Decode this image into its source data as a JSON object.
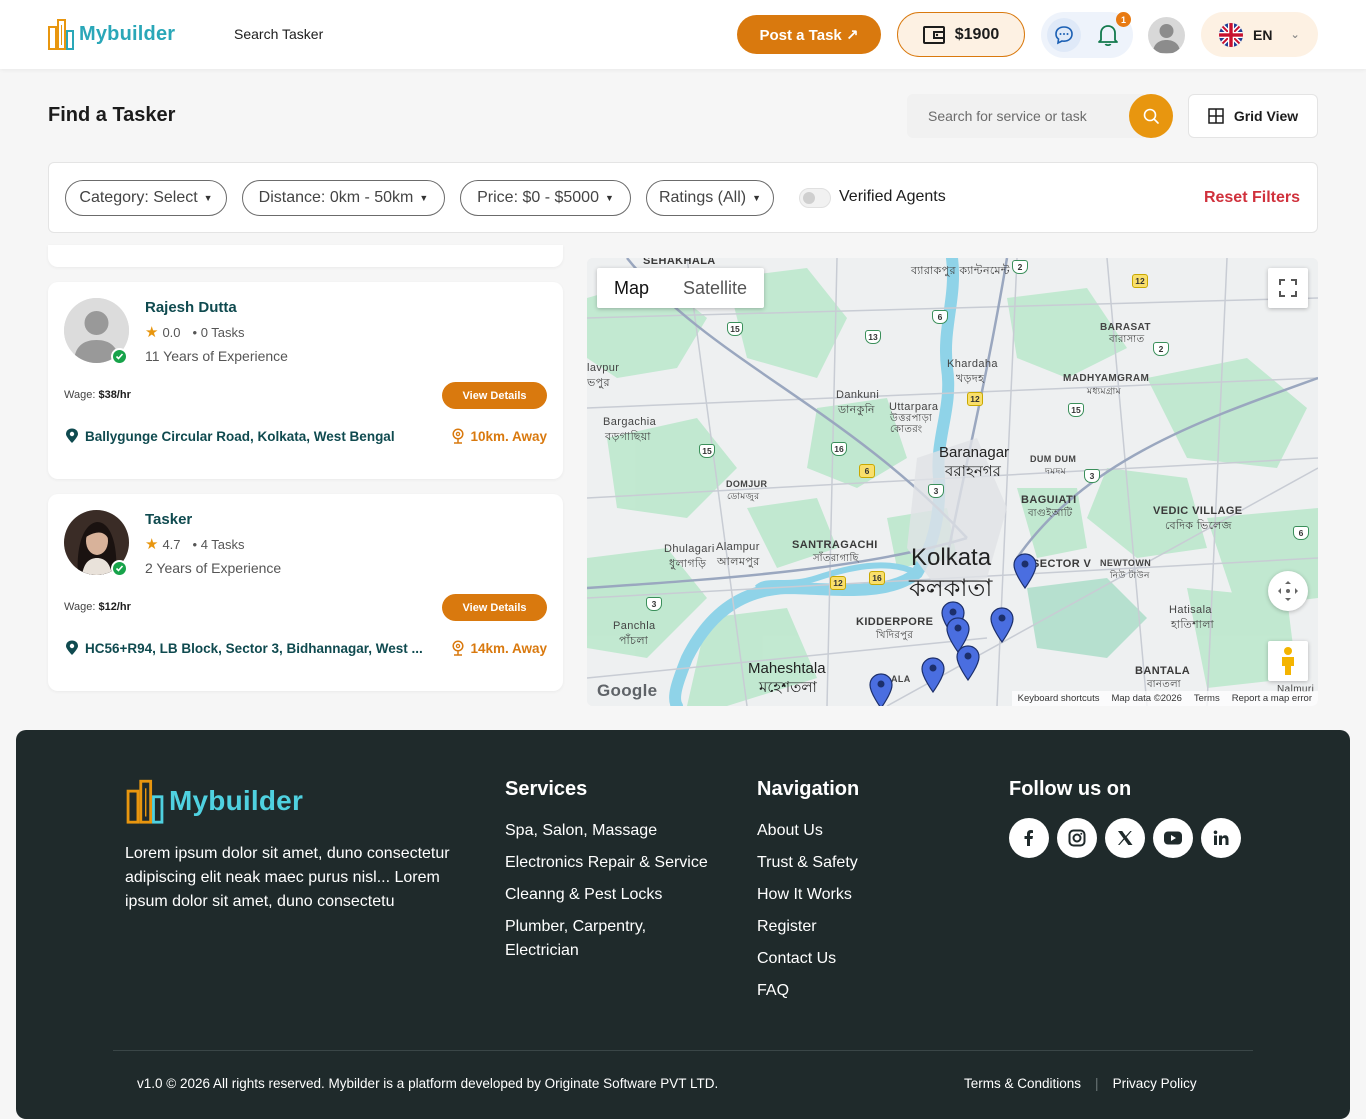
{
  "header": {
    "brand": "Mybuilder",
    "search_tasker": "Search Tasker",
    "post_task": "Post a Task ↗",
    "wallet_balance": "$1900",
    "notification_count": "1",
    "language": "EN"
  },
  "page": {
    "title": "Find a Tasker",
    "search_placeholder": "Search for service or task",
    "grid_view": "Grid View"
  },
  "filters": {
    "category": "Category: Select",
    "distance": "Distance: 0km - 50km",
    "price": "Price: $0 - $5000",
    "ratings": "Ratings (All)",
    "verified_label": "Verified Agents",
    "verified_on": false,
    "reset": "Reset Filters"
  },
  "taskers": [
    {
      "name": "Rajesh Dutta",
      "rating": "0.0",
      "tasks": "• 0 Tasks",
      "experience": "11 Years of Experience",
      "wage_label": "Wage:",
      "wage": "$38/hr",
      "view": "View Details",
      "location": "Ballygunge Circular Road, Kolkata, West Bengal",
      "distance": "10km. Away",
      "verified": true
    },
    {
      "name": "Tasker",
      "rating": "4.7",
      "tasks": "• 4 Tasks",
      "experience": "2 Years of Experience",
      "wage_label": "Wage:",
      "wage": "$12/hr",
      "view": "View Details",
      "location": "HC56+R94, LB Block, Sector 3, Bidhannagar, West ...",
      "distance": "14km. Away",
      "verified": true
    }
  ],
  "map": {
    "tab_map": "Map",
    "tab_satellite": "Satellite",
    "city": "Kolkata",
    "city_local": "কলকাতা",
    "labels": {
      "sekhala": "SEHAKHALA",
      "barrackpore": "ব্যারাকপুর ক্যান্টনমেন্ট",
      "barasat": "BARASAT",
      "barasat_bn": "বারাসাত",
      "khardaha": "Khardaha",
      "khardaha_bn": "খড়দহ",
      "madhyamgram": "MADHYAMGRAM",
      "madhyamgram_bn": "মধ্যমগ্রাম",
      "dankuni": "Dankuni",
      "dankuni_bn": "ডানকুনি",
      "uttarpara": "Uttarpara",
      "uttarpara_bn": "উত্তরপাড়া কোতরং",
      "bargachia": "Bargachia",
      "bargachia_bn": "বড়গাছিয়া",
      "baranagar": "Baranagar",
      "baranagar_bn": "বরাহনগর",
      "dumdum": "DUM DUM",
      "dumdum_bn": "দমদম",
      "domjur": "DOMJUR",
      "domjur_bn": "ডোমজুর",
      "baguiati": "BAGUIATI",
      "baguiati_bn": "বাগুইআটি",
      "vedic": "VEDIC VILLAGE",
      "vedic_bn": "বেদিক ভিলেজ",
      "santragachi": "SANTRAGACHI",
      "santragachi_bn": "সাঁতরাগাছি",
      "dhulagari": "Dhulagari",
      "dhulagari_bn": "ধুলাগড়ি",
      "alampur": "Alampur",
      "alampur_bn": "আলমপুর",
      "sector": "SECTOR V",
      "newtown": "NEWTOWN",
      "newtown_bn": "নিউ টাউন",
      "panchla": "Panchla",
      "panchla_bn": "পাঁচলা",
      "kidderpore": "KIDDERPORE",
      "kidderpore_bn": "খিদিরপুর",
      "hatisala": "Hatisala",
      "hatisala_bn": "হাতিশালা",
      "maheshtala": "Maheshtala",
      "maheshtala_bn": "মহেশতলা",
      "bantala": "BANTALA",
      "bantala_bn": "বানতলা",
      "lavpur": "lavpur",
      "lavpur_bn": "ভপুর",
      "nalmuri": "Nalmuri",
      "ala": "ALA"
    },
    "google": "Google",
    "attrib": [
      "Keyboard shortcuts",
      "Map data ©2026",
      "Terms",
      "Report a map error"
    ],
    "road_numbers": [
      "2",
      "12",
      "6",
      "15",
      "13",
      "2",
      "12",
      "15",
      "15",
      "16",
      "6",
      "3",
      "3",
      "6",
      "12",
      "16",
      "3"
    ]
  },
  "footer": {
    "brand": "Mybuilder",
    "description": "Lorem ipsum dolor sit amet, duno consectetur adipiscing elit neak maec purus nisl... Lorem ipsum dolor sit amet, duno consectetu",
    "services_title": "Services",
    "services": [
      "Spa, Salon, Massage",
      "Electronics Repair & Service",
      "Cleanng & Pest Locks",
      "Plumber, Carpentry, Electrician"
    ],
    "navigation_title": "Navigation",
    "navigation": [
      "About Us",
      "Trust & Safety",
      "How It Works",
      "Register",
      "Contact Us",
      "FAQ"
    ],
    "follow_title": "Follow us on",
    "copyright": "v1.0 © 2026 All rights reserved. Mybilder is a platform developed by Originate Software PVT LTD.",
    "terms": "Terms & Conditions",
    "privacy": "Privacy Policy"
  },
  "colors": {
    "accent": "#d9790e",
    "teal": "#0f4a4f",
    "danger": "#d0313c",
    "footer_bg": "#1f2a2b"
  }
}
